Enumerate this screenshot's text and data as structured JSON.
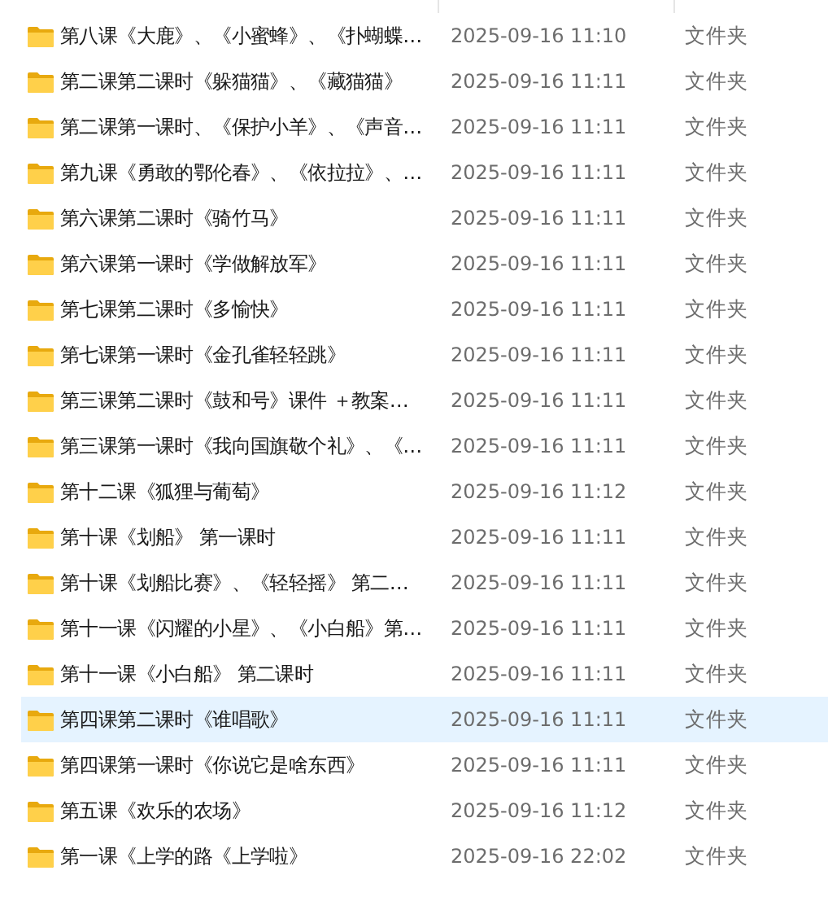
{
  "rows": [
    {
      "name": "第八课《大鹿》、《小蜜蜂》、《扑蝴蝶…",
      "modified": "2025-09-16 11:10",
      "type": "文件夹",
      "selected": false
    },
    {
      "name": "第二课第二课时《躲猫猫》、《藏猫猫》",
      "modified": "2025-09-16 11:11",
      "type": "文件夹",
      "selected": false
    },
    {
      "name": "第二课第一课时、《保护小羊》、《声音…",
      "modified": "2025-09-16 11:11",
      "type": "文件夹",
      "selected": false
    },
    {
      "name": "第九课《勇敢的鄂伦春》、《依拉拉》、…",
      "modified": "2025-09-16 11:11",
      "type": "文件夹",
      "selected": false
    },
    {
      "name": "第六课第二课时《骑竹马》",
      "modified": "2025-09-16 11:11",
      "type": "文件夹",
      "selected": false
    },
    {
      "name": "第六课第一课时《学做解放军》",
      "modified": "2025-09-16 11:11",
      "type": "文件夹",
      "selected": false
    },
    {
      "name": "第七课第二课时《多愉快》",
      "modified": "2025-09-16 11:11",
      "type": "文件夹",
      "selected": false
    },
    {
      "name": "第七课第一课时《金孔雀轻轻跳》",
      "modified": "2025-09-16 11:11",
      "type": "文件夹",
      "selected": false
    },
    {
      "name": "第三课第二课时《鼓和号》课件 ＋教案…",
      "modified": "2025-09-16 11:11",
      "type": "文件夹",
      "selected": false
    },
    {
      "name": "第三课第一课时《我向国旗敬个礼》、《…",
      "modified": "2025-09-16 11:11",
      "type": "文件夹",
      "selected": false
    },
    {
      "name": "第十二课《狐狸与葡萄》",
      "modified": "2025-09-16 11:12",
      "type": "文件夹",
      "selected": false
    },
    {
      "name": "第十课《划船》 第一课时",
      "modified": "2025-09-16 11:11",
      "type": "文件夹",
      "selected": false
    },
    {
      "name": "第十课《划船比赛》、《轻轻摇》 第二…",
      "modified": "2025-09-16 11:11",
      "type": "文件夹",
      "selected": false
    },
    {
      "name": "第十一课《闪耀的小星》、《小白船》第…",
      "modified": "2025-09-16 11:11",
      "type": "文件夹",
      "selected": false
    },
    {
      "name": "第十一课《小白船》 第二课时",
      "modified": "2025-09-16 11:11",
      "type": "文件夹",
      "selected": false
    },
    {
      "name": "第四课第二课时《谁唱歌》",
      "modified": "2025-09-16 11:11",
      "type": "文件夹",
      "selected": true
    },
    {
      "name": "第四课第一课时《你说它是啥东西》",
      "modified": "2025-09-16 11:11",
      "type": "文件夹",
      "selected": false
    },
    {
      "name": "第五课《欢乐的农场》",
      "modified": "2025-09-16 11:12",
      "type": "文件夹",
      "selected": false
    },
    {
      "name": "第一课《上学的路《上学啦》",
      "modified": "2025-09-16 22:02",
      "type": "文件夹",
      "selected": false
    }
  ]
}
